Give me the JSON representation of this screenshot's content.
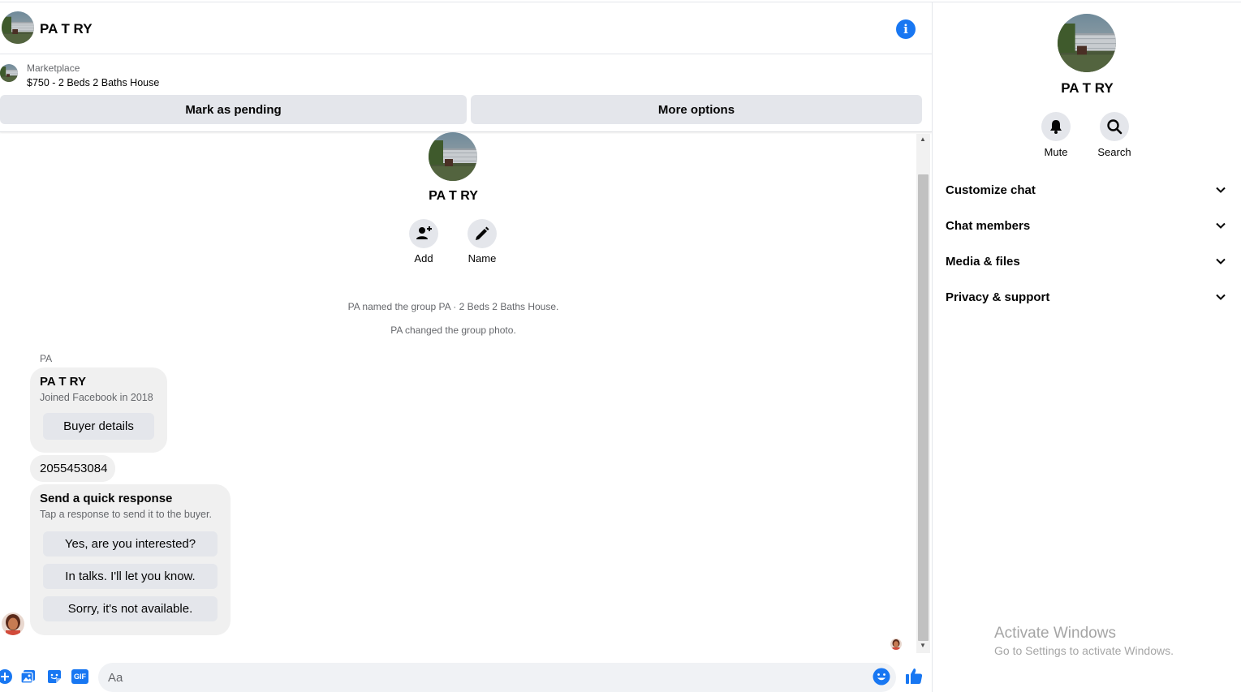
{
  "conversation": {
    "title": "PA T RY",
    "info_icon": "info-icon"
  },
  "product": {
    "category": "Marketplace",
    "listing": "$750 - 2 Beds 2 Baths House",
    "mark_pending_label": "Mark as pending",
    "more_options_label": "More options"
  },
  "thread": {
    "contact_name": "PA T RY",
    "actions": [
      {
        "label": "Add",
        "icon": "add-person-icon"
      },
      {
        "label": "Name",
        "icon": "pencil-icon"
      }
    ],
    "system_messages": [
      "PA named the group PA · 2 Beds 2 Baths House.",
      "PA changed the group photo."
    ],
    "sender": "PA",
    "profile_card": {
      "name": "PA T RY",
      "joined": "Joined Facebook in 2018",
      "button": "Buyer details"
    },
    "phone_message": "2055453084",
    "quick_response": {
      "title": "Send a quick response",
      "subtitle": "Tap a response to send it to the buyer.",
      "options": [
        "Yes, are you interested?",
        "In talks. I'll let you know.",
        "Sorry, it's not available."
      ]
    }
  },
  "composer": {
    "placeholder": "Aa",
    "icons": [
      "plus-icon",
      "photo-icon",
      "sticker-icon",
      "gif-icon",
      "emoji-icon",
      "like-icon"
    ],
    "gif_label": "GIF"
  },
  "side_panel": {
    "name": "PA T RY",
    "actions": [
      {
        "label": "Mute",
        "icon": "bell-icon"
      },
      {
        "label": "Search",
        "icon": "search-icon"
      }
    ],
    "sections": [
      "Customize chat",
      "Chat members",
      "Media & files",
      "Privacy & support"
    ]
  },
  "watermark": {
    "line1": "Activate Windows",
    "line2": "Go to Settings to activate Windows."
  },
  "colors": {
    "accent": "#1877f2",
    "button_bg": "#e4e6eb",
    "bubble_bg": "#f0f0f0",
    "secondary_text": "#65676b"
  }
}
